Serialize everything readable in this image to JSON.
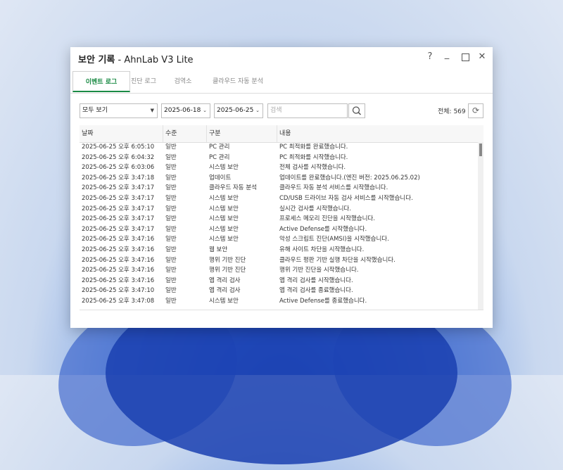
{
  "window": {
    "title": "보안 기록",
    "subtitle": " - AhnLab V3 Lite",
    "help": "?",
    "close": "✕"
  },
  "tabs": [
    {
      "label": "이벤트 로그",
      "active": true
    },
    {
      "label": "진단 로그",
      "active": false
    },
    {
      "label": "검역소",
      "active": false
    },
    {
      "label": "클라우드 자동 분석",
      "active": false
    }
  ],
  "filters": {
    "view_select": "모두 보기",
    "date_from": "2025-06-18",
    "date_to": "2025-06-25",
    "search_placeholder": "검색",
    "total": "전체: 569"
  },
  "table": {
    "columns": [
      "날짜",
      "수준",
      "구분",
      "내용"
    ],
    "rows": [
      [
        "2025-06-25 오후 6:05:10",
        "일반",
        "PC 관리",
        "PC 최적화를 완료했습니다."
      ],
      [
        "2025-06-25 오후 6:04:32",
        "일반",
        "PC 관리",
        "PC 최적화를 시작했습니다."
      ],
      [
        "2025-06-25 오후 6:03:06",
        "일반",
        "시스템 보안",
        "전체 검사를 시작했습니다."
      ],
      [
        "2025-06-25 오후 3:47:18",
        "일반",
        "업데이트",
        "업데이트를 완료했습니다.(엔진 버전: 2025.06.25.02)"
      ],
      [
        "2025-06-25 오후 3:47:17",
        "일반",
        "클라우드 자동 분석",
        "클라우드 자동 분석 서비스를 시작했습니다."
      ],
      [
        "2025-06-25 오후 3:47:17",
        "일반",
        "시스템 보안",
        "CD/USB 드라이브 자동 검사 서비스를 시작했습니다."
      ],
      [
        "2025-06-25 오후 3:47:17",
        "일반",
        "시스템 보안",
        "실시간 검사를 시작했습니다."
      ],
      [
        "2025-06-25 오후 3:47:17",
        "일반",
        "시스템 보안",
        "프로세스 메모리 진단을 시작했습니다."
      ],
      [
        "2025-06-25 오후 3:47:17",
        "일반",
        "시스템 보안",
        "Active Defense를 시작했습니다."
      ],
      [
        "2025-06-25 오후 3:47:16",
        "일반",
        "시스템 보안",
        "악성 스크립트 진단(AMSI)을 시작했습니다."
      ],
      [
        "2025-06-25 오후 3:47:16",
        "일반",
        "웹 보안",
        "유해 사이트 차단을 시작했습니다."
      ],
      [
        "2025-06-25 오후 3:47:16",
        "일반",
        "행위 기반 진단",
        "클라우드 평판 기반 실행 차단을 시작했습니다."
      ],
      [
        "2025-06-25 오후 3:47:16",
        "일반",
        "행위 기반 진단",
        "행위 기반 진단을 시작했습니다."
      ],
      [
        "2025-06-25 오후 3:47:16",
        "일반",
        "앱 격리 검사",
        "앱 격리 검사를 시작했습니다."
      ],
      [
        "2025-06-25 오후 3:47:10",
        "일반",
        "앱 격리 검사",
        "앱 격리 검사를 종료했습니다."
      ],
      [
        "2025-06-25 오후 3:47:08",
        "일반",
        "시스템 보안",
        "Active Defense를 종료했습니다."
      ]
    ]
  },
  "colors": {
    "accent": "#1a8a44"
  }
}
